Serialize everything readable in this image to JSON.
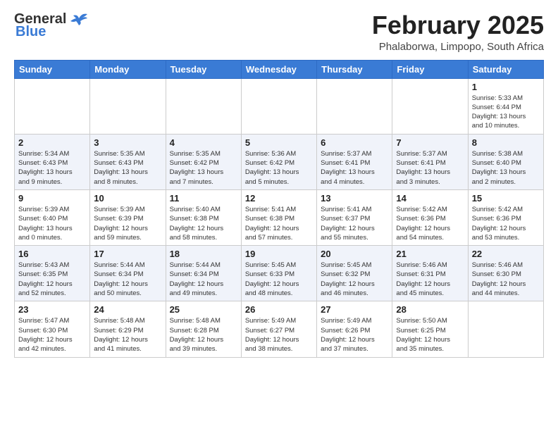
{
  "header": {
    "logo_line1": "General",
    "logo_line2": "Blue",
    "month": "February 2025",
    "location": "Phalaborwa, Limpopo, South Africa"
  },
  "weekdays": [
    "Sunday",
    "Monday",
    "Tuesday",
    "Wednesday",
    "Thursday",
    "Friday",
    "Saturday"
  ],
  "weeks": [
    [
      {
        "day": "",
        "info": ""
      },
      {
        "day": "",
        "info": ""
      },
      {
        "day": "",
        "info": ""
      },
      {
        "day": "",
        "info": ""
      },
      {
        "day": "",
        "info": ""
      },
      {
        "day": "",
        "info": ""
      },
      {
        "day": "1",
        "info": "Sunrise: 5:33 AM\nSunset: 6:44 PM\nDaylight: 13 hours\nand 10 minutes."
      }
    ],
    [
      {
        "day": "2",
        "info": "Sunrise: 5:34 AM\nSunset: 6:43 PM\nDaylight: 13 hours\nand 9 minutes."
      },
      {
        "day": "3",
        "info": "Sunrise: 5:35 AM\nSunset: 6:43 PM\nDaylight: 13 hours\nand 8 minutes."
      },
      {
        "day": "4",
        "info": "Sunrise: 5:35 AM\nSunset: 6:42 PM\nDaylight: 13 hours\nand 7 minutes."
      },
      {
        "day": "5",
        "info": "Sunrise: 5:36 AM\nSunset: 6:42 PM\nDaylight: 13 hours\nand 5 minutes."
      },
      {
        "day": "6",
        "info": "Sunrise: 5:37 AM\nSunset: 6:41 PM\nDaylight: 13 hours\nand 4 minutes."
      },
      {
        "day": "7",
        "info": "Sunrise: 5:37 AM\nSunset: 6:41 PM\nDaylight: 13 hours\nand 3 minutes."
      },
      {
        "day": "8",
        "info": "Sunrise: 5:38 AM\nSunset: 6:40 PM\nDaylight: 13 hours\nand 2 minutes."
      }
    ],
    [
      {
        "day": "9",
        "info": "Sunrise: 5:39 AM\nSunset: 6:40 PM\nDaylight: 13 hours\nand 0 minutes."
      },
      {
        "day": "10",
        "info": "Sunrise: 5:39 AM\nSunset: 6:39 PM\nDaylight: 12 hours\nand 59 minutes."
      },
      {
        "day": "11",
        "info": "Sunrise: 5:40 AM\nSunset: 6:38 PM\nDaylight: 12 hours\nand 58 minutes."
      },
      {
        "day": "12",
        "info": "Sunrise: 5:41 AM\nSunset: 6:38 PM\nDaylight: 12 hours\nand 57 minutes."
      },
      {
        "day": "13",
        "info": "Sunrise: 5:41 AM\nSunset: 6:37 PM\nDaylight: 12 hours\nand 55 minutes."
      },
      {
        "day": "14",
        "info": "Sunrise: 5:42 AM\nSunset: 6:36 PM\nDaylight: 12 hours\nand 54 minutes."
      },
      {
        "day": "15",
        "info": "Sunrise: 5:42 AM\nSunset: 6:36 PM\nDaylight: 12 hours\nand 53 minutes."
      }
    ],
    [
      {
        "day": "16",
        "info": "Sunrise: 5:43 AM\nSunset: 6:35 PM\nDaylight: 12 hours\nand 52 minutes."
      },
      {
        "day": "17",
        "info": "Sunrise: 5:44 AM\nSunset: 6:34 PM\nDaylight: 12 hours\nand 50 minutes."
      },
      {
        "day": "18",
        "info": "Sunrise: 5:44 AM\nSunset: 6:34 PM\nDaylight: 12 hours\nand 49 minutes."
      },
      {
        "day": "19",
        "info": "Sunrise: 5:45 AM\nSunset: 6:33 PM\nDaylight: 12 hours\nand 48 minutes."
      },
      {
        "day": "20",
        "info": "Sunrise: 5:45 AM\nSunset: 6:32 PM\nDaylight: 12 hours\nand 46 minutes."
      },
      {
        "day": "21",
        "info": "Sunrise: 5:46 AM\nSunset: 6:31 PM\nDaylight: 12 hours\nand 45 minutes."
      },
      {
        "day": "22",
        "info": "Sunrise: 5:46 AM\nSunset: 6:30 PM\nDaylight: 12 hours\nand 44 minutes."
      }
    ],
    [
      {
        "day": "23",
        "info": "Sunrise: 5:47 AM\nSunset: 6:30 PM\nDaylight: 12 hours\nand 42 minutes."
      },
      {
        "day": "24",
        "info": "Sunrise: 5:48 AM\nSunset: 6:29 PM\nDaylight: 12 hours\nand 41 minutes."
      },
      {
        "day": "25",
        "info": "Sunrise: 5:48 AM\nSunset: 6:28 PM\nDaylight: 12 hours\nand 39 minutes."
      },
      {
        "day": "26",
        "info": "Sunrise: 5:49 AM\nSunset: 6:27 PM\nDaylight: 12 hours\nand 38 minutes."
      },
      {
        "day": "27",
        "info": "Sunrise: 5:49 AM\nSunset: 6:26 PM\nDaylight: 12 hours\nand 37 minutes."
      },
      {
        "day": "28",
        "info": "Sunrise: 5:50 AM\nSunset: 6:25 PM\nDaylight: 12 hours\nand 35 minutes."
      },
      {
        "day": "",
        "info": ""
      }
    ]
  ]
}
